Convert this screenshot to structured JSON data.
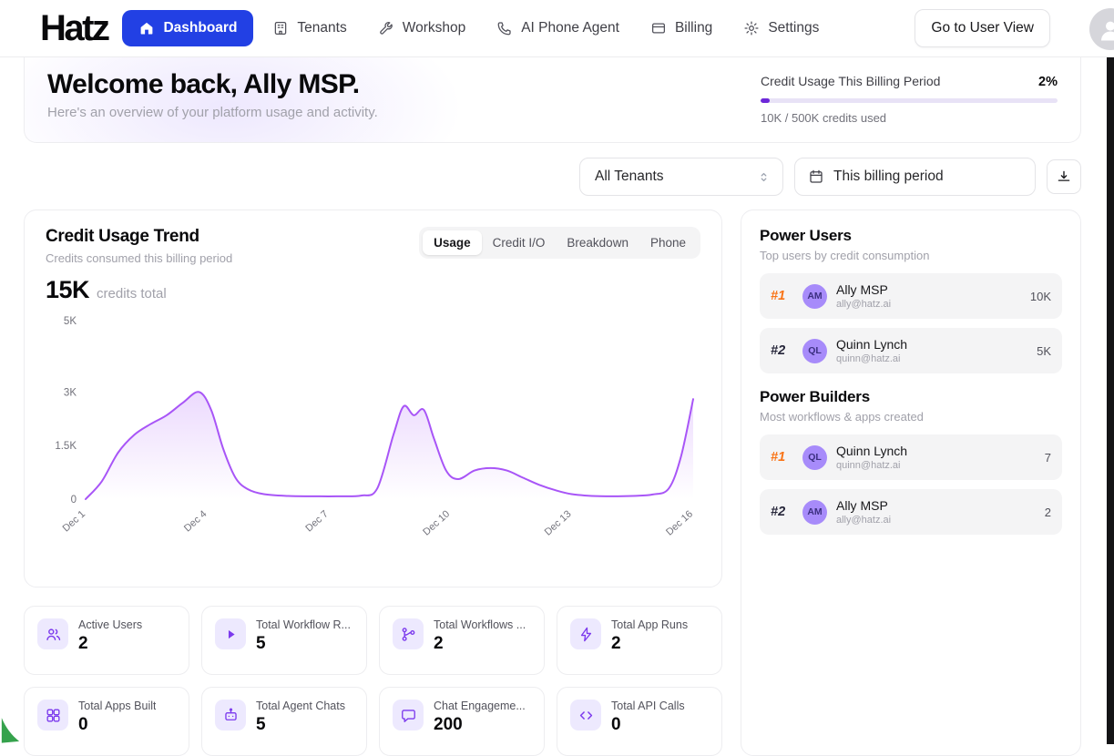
{
  "brand": {
    "logo": "Hatz"
  },
  "nav": {
    "items": [
      {
        "label": "Dashboard",
        "icon": "home-icon",
        "active": true
      },
      {
        "label": "Tenants",
        "icon": "building-icon",
        "active": false
      },
      {
        "label": "Workshop",
        "icon": "wrench-icon",
        "active": false
      },
      {
        "label": "AI Phone Agent",
        "icon": "phone-icon",
        "active": false
      },
      {
        "label": "Billing",
        "icon": "credit-card-icon",
        "active": false
      },
      {
        "label": "Settings",
        "icon": "gear-icon",
        "active": false
      }
    ],
    "user_view_button": "Go to User View"
  },
  "welcome": {
    "title": "Welcome back, Ally MSP.",
    "subtitle": "Here's an overview of your platform usage and activity."
  },
  "credit_usage": {
    "label": "Credit Usage This Billing Period",
    "percent": "2%",
    "percent_value": 2,
    "detail": "10K / 500K credits used",
    "accent_color": "#6d28d9"
  },
  "filters": {
    "tenant_select": "All Tenants",
    "period": "This billing period"
  },
  "trend": {
    "title": "Credit Usage Trend",
    "subtitle": "Credits consumed this billing period",
    "total": "15K",
    "total_suffix": "credits total",
    "tabs": [
      {
        "label": "Usage",
        "active": true
      },
      {
        "label": "Credit I/O",
        "active": false
      },
      {
        "label": "Breakdown",
        "active": false
      },
      {
        "label": "Phone",
        "active": false
      }
    ]
  },
  "chart_data": {
    "type": "area",
    "title": "Credit Usage Trend",
    "xlabel": "",
    "ylabel": "",
    "xlim": [
      1,
      16
    ],
    "ylim": [
      0,
      5000
    ],
    "grid": false,
    "legend": "none",
    "line_color": "#a855f7",
    "fill_color": "rgba(168,85,247,0.18)",
    "yticks": [
      {
        "label": "5K",
        "value": 5000
      },
      {
        "label": "3K",
        "value": 3000
      },
      {
        "label": "1.5K",
        "value": 1500
      },
      {
        "label": "0",
        "value": 0
      }
    ],
    "xticks": [
      {
        "label": "Dec 1",
        "day": 1
      },
      {
        "label": "Dec 4",
        "day": 4
      },
      {
        "label": "Dec 7",
        "day": 7
      },
      {
        "label": "Dec 10",
        "day": 10
      },
      {
        "label": "Dec 13",
        "day": 13
      },
      {
        "label": "Dec 16",
        "day": 16
      }
    ],
    "series": [
      {
        "name": "Credits consumed",
        "points": [
          [
            1,
            0
          ],
          [
            1.4,
            500
          ],
          [
            1.8,
            1300
          ],
          [
            2.2,
            1800
          ],
          [
            2.6,
            2100
          ],
          [
            3,
            2350
          ],
          [
            3.4,
            2700
          ],
          [
            3.8,
            3000
          ],
          [
            4.1,
            2500
          ],
          [
            4.4,
            1400
          ],
          [
            4.7,
            600
          ],
          [
            5,
            280
          ],
          [
            5.4,
            140
          ],
          [
            6,
            90
          ],
          [
            6.6,
            80
          ],
          [
            7.2,
            80
          ],
          [
            7.8,
            100
          ],
          [
            8.2,
            300
          ],
          [
            8.6,
            1800
          ],
          [
            8.85,
            2600
          ],
          [
            9.1,
            2350
          ],
          [
            9.35,
            2500
          ],
          [
            9.6,
            1700
          ],
          [
            9.9,
            800
          ],
          [
            10.2,
            560
          ],
          [
            10.6,
            800
          ],
          [
            11,
            870
          ],
          [
            11.4,
            800
          ],
          [
            11.8,
            600
          ],
          [
            12.2,
            400
          ],
          [
            12.6,
            250
          ],
          [
            13,
            140
          ],
          [
            13.5,
            90
          ],
          [
            14,
            80
          ],
          [
            14.5,
            90
          ],
          [
            15,
            130
          ],
          [
            15.4,
            300
          ],
          [
            15.7,
            1200
          ],
          [
            16,
            2800
          ]
        ]
      }
    ]
  },
  "power_users": {
    "title": "Power Users",
    "subtitle": "Top users by credit consumption",
    "rows": [
      {
        "rank": "#1",
        "initials": "AM",
        "name": "Ally MSP",
        "email": "ally@hatz.ai",
        "value": "10K"
      },
      {
        "rank": "#2",
        "initials": "QL",
        "name": "Quinn Lynch",
        "email": "quinn@hatz.ai",
        "value": "5K"
      }
    ]
  },
  "power_builders": {
    "title": "Power Builders",
    "subtitle": "Most workflows & apps created",
    "rows": [
      {
        "rank": "#1",
        "initials": "QL",
        "name": "Quinn Lynch",
        "email": "quinn@hatz.ai",
        "value": "7"
      },
      {
        "rank": "#2",
        "initials": "AM",
        "name": "Ally MSP",
        "email": "ally@hatz.ai",
        "value": "2"
      }
    ]
  },
  "stats": [
    {
      "label": "Active Users",
      "value": "2",
      "icon": "users-icon"
    },
    {
      "label": "Total Workflow R...",
      "value": "5",
      "icon": "play-icon"
    },
    {
      "label": "Total Workflows ...",
      "value": "2",
      "icon": "workflow-icon"
    },
    {
      "label": "Total App Runs",
      "value": "2",
      "icon": "bolt-icon"
    },
    {
      "label": "Total Apps Built",
      "value": "0",
      "icon": "grid-icon"
    },
    {
      "label": "Total Agent Chats",
      "value": "5",
      "icon": "bot-icon"
    },
    {
      "label": "Chat Engageme...",
      "value": "200",
      "icon": "chat-bubble-icon"
    },
    {
      "label": "Total API Calls",
      "value": "0",
      "icon": "code-icon"
    }
  ],
  "colors": {
    "primary_blue": "#2240e4",
    "purple_accent": "#7c3aed",
    "rank1_color": "#f97316",
    "progress_fill": "#6d28d9",
    "chart_line": "#a855f7"
  }
}
